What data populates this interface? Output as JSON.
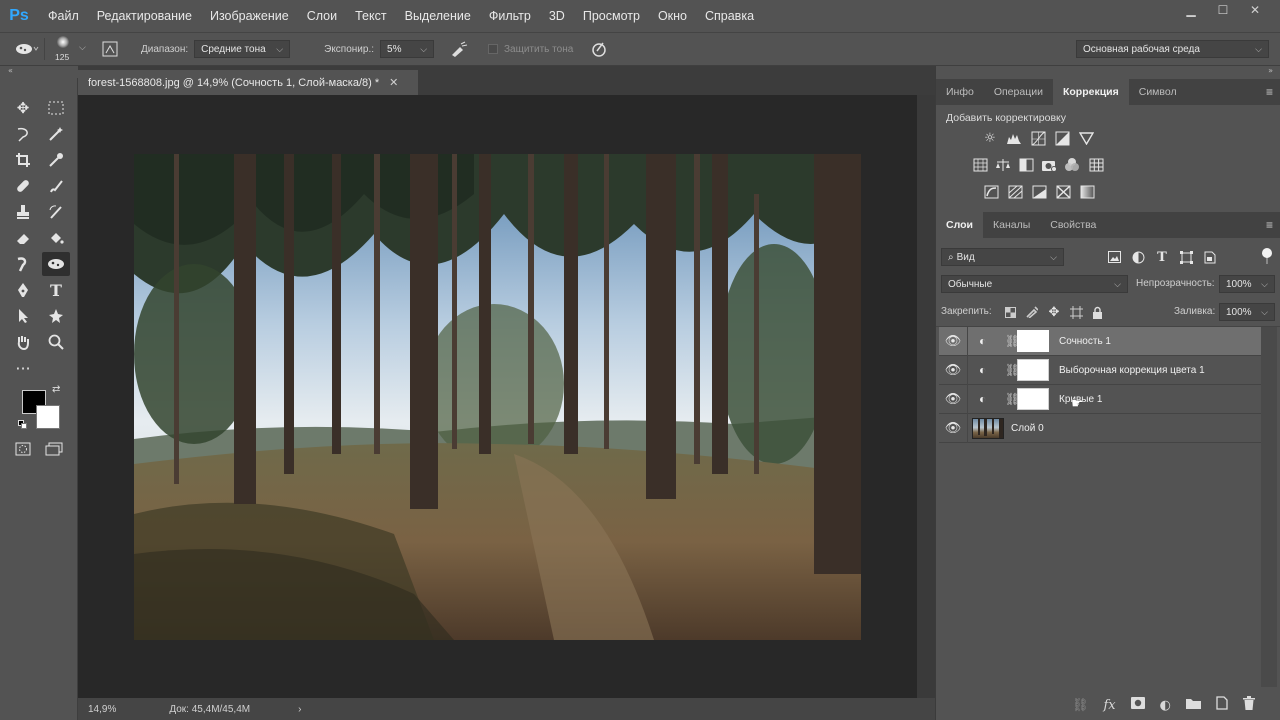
{
  "app": {
    "logo": "Ps",
    "menu": [
      "Файл",
      "Редактирование",
      "Изображение",
      "Слои",
      "Текст",
      "Выделение",
      "Фильтр",
      "3D",
      "Просмотр",
      "Окно",
      "Справка"
    ],
    "window_controls": [
      "minimize-icon",
      "maximize-icon",
      "close-icon"
    ]
  },
  "options": {
    "brush_size": "125",
    "range_label": "Диапазон:",
    "range_value": "Средние тона",
    "exposure_label": "Экспонир.:",
    "exposure_value": "5%",
    "protect_label": "Защитить тона",
    "workspace": "Основная рабочая среда"
  },
  "document": {
    "tab_title": "forest-1568808.jpg @ 14,9% (Сочность 1, Слой-маска/8) *",
    "zoom": "14,9%",
    "doc_size": "Док: 45,4M/45,4M"
  },
  "top_panel": {
    "tabs": [
      "Инфо",
      "Операции",
      "Коррекция",
      "Символ"
    ],
    "active_tab": 2,
    "adjustments_title": "Добавить корректировку"
  },
  "layers_panel": {
    "tabs": [
      "Слои",
      "Каналы",
      "Свойства"
    ],
    "active_tab": 0,
    "filter_kind": "Вид",
    "blend_mode": "Обычные",
    "opacity_label": "Непрозрачность:",
    "opacity_value": "100%",
    "lock_label": "Закрепить:",
    "fill_label": "Заливка:",
    "fill_value": "100%",
    "layers": [
      {
        "name": "Сочность 1",
        "type": "adjustment",
        "selected": true
      },
      {
        "name": "Выборочная коррекция цвета 1",
        "type": "adjustment",
        "selected": false
      },
      {
        "name": "Кривые 1",
        "type": "adjustment",
        "selected": false
      },
      {
        "name": "Слой 0",
        "type": "pixel",
        "selected": false
      }
    ]
  },
  "colors": {
    "ui_bg": "#535353",
    "canvas_bg": "#282828",
    "ps_blue": "#31a8ff",
    "foreground": "#000000",
    "background": "#ffffff"
  }
}
